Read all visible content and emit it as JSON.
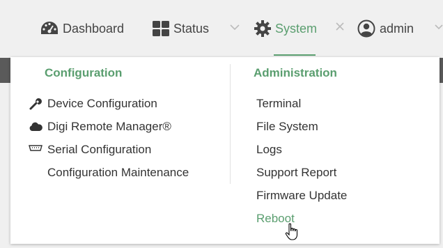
{
  "nav": {
    "dashboard_label": "Dashboard",
    "status_label": "Status",
    "system_label": "System",
    "admin_label": "admin"
  },
  "menu": {
    "configuration": {
      "heading": "Configuration",
      "items": [
        {
          "label": "Device Configuration",
          "icon": "wrench-icon"
        },
        {
          "label": "Digi Remote Manager®",
          "icon": "cloud-icon"
        },
        {
          "label": "Serial Configuration",
          "icon": "serial-port-icon"
        },
        {
          "label": "Configuration Maintenance",
          "icon": ""
        }
      ]
    },
    "administration": {
      "heading": "Administration",
      "items": [
        {
          "label": "Terminal"
        },
        {
          "label": "File System"
        },
        {
          "label": "Logs"
        },
        {
          "label": "Support Report"
        },
        {
          "label": "Firmware Update"
        },
        {
          "label": "Reboot",
          "state": "hovered"
        }
      ]
    }
  },
  "colors": {
    "accent": "#5a9e6f",
    "text": "#333333",
    "background": "#f0f0f0",
    "panel": "#ffffff"
  }
}
